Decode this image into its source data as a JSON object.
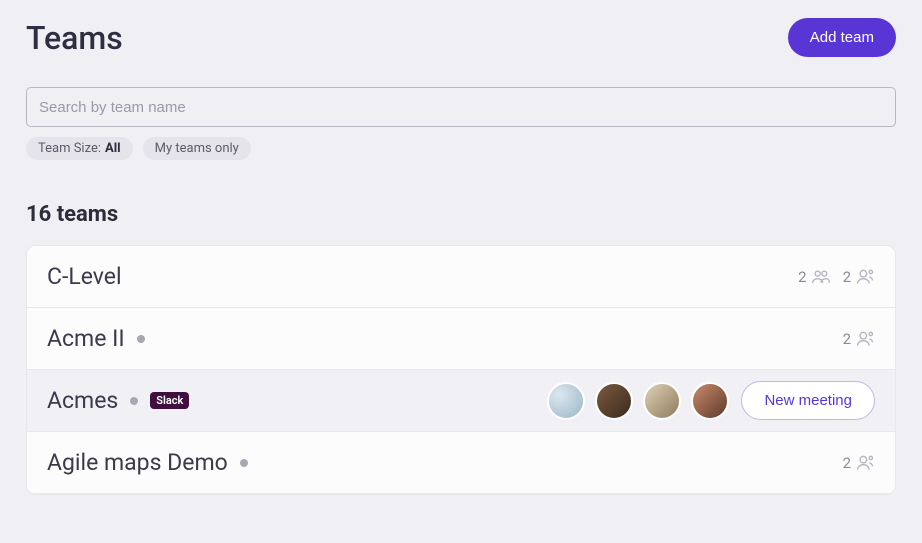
{
  "header": {
    "title": "Teams",
    "add_button": "Add team"
  },
  "search": {
    "placeholder": "Search by team name",
    "value": ""
  },
  "filters": {
    "team_size": {
      "label": "Team Size:",
      "value": "All"
    },
    "my_teams": {
      "label": "My teams only"
    }
  },
  "count": {
    "label": "16 teams"
  },
  "teams": [
    {
      "name": "C-Level",
      "status_dot": false,
      "slack": false,
      "hovered": false,
      "avatars": [],
      "stats": [
        {
          "value": "2",
          "icon": "group-icon"
        },
        {
          "value": "2",
          "icon": "person-icon"
        }
      ],
      "show_new_meeting": false
    },
    {
      "name": "Acme II",
      "status_dot": true,
      "slack": false,
      "hovered": false,
      "avatars": [],
      "stats": [
        {
          "value": "2",
          "icon": "person-icon"
        }
      ],
      "show_new_meeting": false
    },
    {
      "name": "Acmes",
      "status_dot": true,
      "slack": true,
      "slack_label": "Slack",
      "hovered": true,
      "avatars": [
        "av1",
        "av2",
        "av3",
        "av4"
      ],
      "stats": [],
      "show_new_meeting": true,
      "new_meeting_label": "New meeting"
    },
    {
      "name": "Agile maps Demo",
      "status_dot": true,
      "slack": false,
      "hovered": false,
      "avatars": [],
      "stats": [
        {
          "value": "2",
          "icon": "person-icon"
        }
      ],
      "show_new_meeting": false
    }
  ]
}
